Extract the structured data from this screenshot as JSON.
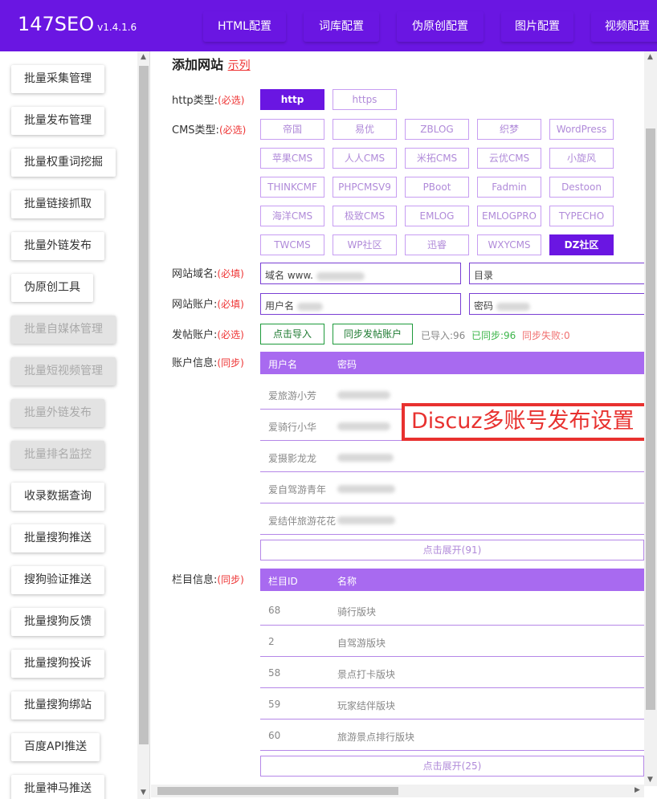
{
  "app": {
    "logo": "147SEO",
    "version": "v1.4.1.6",
    "colors": {
      "primary": "#6a16e2",
      "header_light": "#a86af0",
      "required": "#e33333",
      "success": "#1e9a3b",
      "annotation": "#e8312f"
    }
  },
  "nav": {
    "tabs": [
      "HTML配置",
      "词库配置",
      "伪原创配置",
      "图片配置",
      "视频配置"
    ]
  },
  "sidebar": {
    "items": [
      {
        "label": "批量采集管理",
        "disabled": false
      },
      {
        "label": "批量发布管理",
        "disabled": false
      },
      {
        "label": "批量权重词挖掘",
        "disabled": false
      },
      {
        "label": "批量链接抓取",
        "disabled": false
      },
      {
        "label": "批量外链发布",
        "disabled": false
      },
      {
        "label": "伪原创工具",
        "disabled": false
      },
      {
        "label": "批量自媒体管理",
        "disabled": true
      },
      {
        "label": "批量短视频管理",
        "disabled": true
      },
      {
        "label": "批量外链发布",
        "disabled": true
      },
      {
        "label": "批量排名监控",
        "disabled": true
      },
      {
        "label": "收录数据查询",
        "disabled": false
      },
      {
        "label": "批量搜狗推送",
        "disabled": false
      },
      {
        "label": "搜狗验证推送",
        "disabled": false
      },
      {
        "label": "批量搜狗反馈",
        "disabled": false
      },
      {
        "label": "批量搜狗投诉",
        "disabled": false
      },
      {
        "label": "批量搜狗绑站",
        "disabled": false
      },
      {
        "label": "百度API推送",
        "disabled": false
      },
      {
        "label": "批量神马推送",
        "disabled": false
      }
    ]
  },
  "form": {
    "title": "添加网站",
    "example_link": "示列",
    "http_type": {
      "label": "http类型:",
      "req": "(必选)",
      "options": [
        "http",
        "https"
      ],
      "selected": "http"
    },
    "cms_type": {
      "label": "CMS类型:",
      "req": "(必选)",
      "options": [
        "帝国",
        "易优",
        "ZBLOG",
        "织梦",
        "WordPress",
        "苹果CMS",
        "人人CMS",
        "米拓CMS",
        "云优CMS",
        "小旋风",
        "THINKCMF",
        "PHPCMSV9",
        "PBoot",
        "Fadmin",
        "Destoon",
        "海洋CMS",
        "极致CMS",
        "EMLOG",
        "EMLOGPRO",
        "TYPECHO",
        "TWCMS",
        "WP社区",
        "迅睿",
        "WXYCMS",
        "DZ社区"
      ],
      "selected": "DZ社区"
    },
    "domain": {
      "label": "网站域名:",
      "req": "(必填)",
      "value": "域名 www.",
      "dir_placeholder": "目录"
    },
    "account": {
      "label": "网站账户:",
      "req": "(必填)",
      "user_prefix": "用户名",
      "pass_prefix": "密码"
    },
    "post_account": {
      "label": "发帖账户:",
      "req": "(必选)",
      "import_btn": "点击导入",
      "sync_btn": "同步发帖账户",
      "imported": "已导入:96",
      "synced": "已同步:96",
      "failed": "同步失败:0"
    },
    "account_info": {
      "label": "账户信息:",
      "req": "(同步)",
      "headers": [
        "用户名",
        "密码"
      ],
      "rows": [
        "爱旅游小芳",
        "爱骑行小华",
        "爱摄影龙龙",
        "爱自驾游青年",
        "爱结伴旅游花花"
      ],
      "expand": "点击展开(91)"
    },
    "column_info": {
      "label": "栏目信息:",
      "req": "(同步)",
      "headers": [
        "栏目ID",
        "名称"
      ],
      "rows": [
        {
          "id": "68",
          "name": "骑行版块"
        },
        {
          "id": "2",
          "name": "自驾游版块"
        },
        {
          "id": "58",
          "name": "景点打卡版块"
        },
        {
          "id": "59",
          "name": "玩家结伴版块"
        },
        {
          "id": "60",
          "name": "旅游景点排行版块"
        }
      ],
      "expand": "点击展开(25)"
    }
  },
  "annotation": {
    "text": "Discuz多账号发布设置"
  }
}
